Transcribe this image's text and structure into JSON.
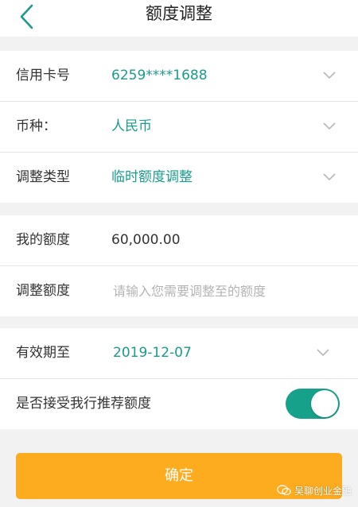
{
  "header": {
    "title": "额度调整",
    "back_icon": "chevron-left-icon"
  },
  "card_section": {
    "card_number": {
      "label": "信用卡号",
      "value": "6259****1688",
      "icon": "chevron-down-icon"
    },
    "currency": {
      "label": "币种：",
      "value": "人民币",
      "icon": "chevron-down-icon"
    },
    "adjust_type": {
      "label": "调整类型",
      "value": "临时额度调整",
      "icon": "chevron-down-icon"
    }
  },
  "limit_section": {
    "my_limit": {
      "label": "我的额度",
      "value": "60,000.00"
    },
    "adjust_amount": {
      "label": "调整额度",
      "placeholder": "请输入您需要调整至的额度"
    }
  },
  "validity_section": {
    "valid_until": {
      "label": "有效期至",
      "value": "2019-12-07",
      "icon": "chevron-down-icon"
    },
    "accept_recommend": {
      "label": "是否接受我行推荐额度",
      "enabled": true
    }
  },
  "confirm_button": {
    "label": "确定"
  },
  "watermark": {
    "text": "吴聊创业金融",
    "icon": "wechat-icon"
  },
  "colors": {
    "accent": "#1a9b8c",
    "toggle_on": "#16a18b",
    "button": "#fdab1f",
    "background": "#f2f2f2"
  }
}
